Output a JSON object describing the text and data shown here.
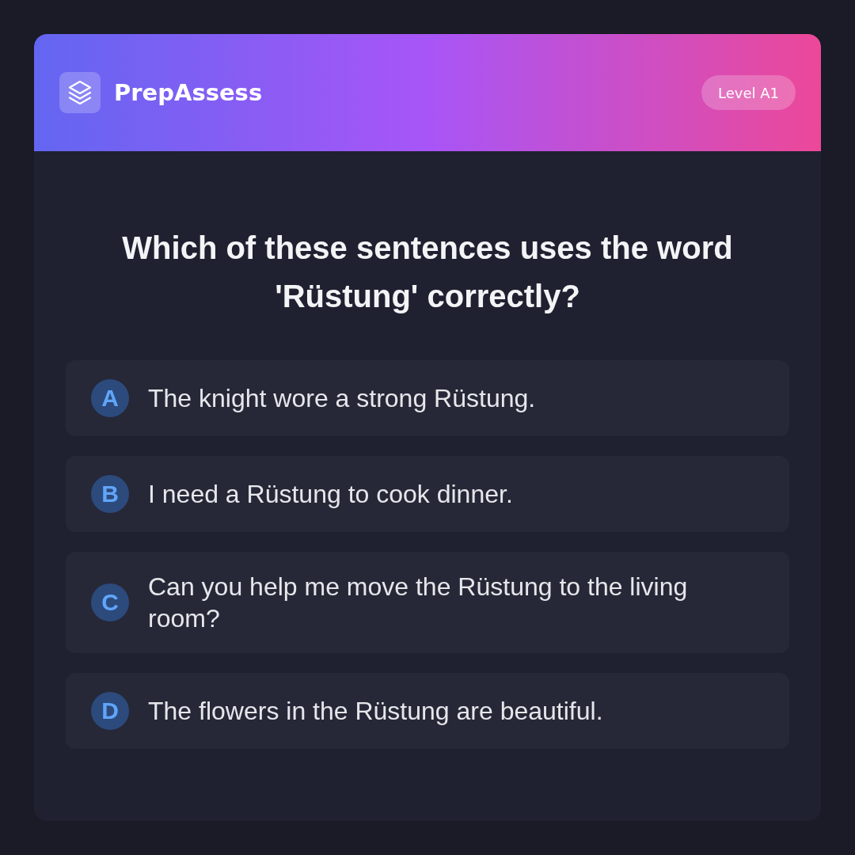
{
  "header": {
    "app_name": "PrepAssess",
    "level_badge": "Level A1"
  },
  "question": "Which of these sentences uses the word 'Rüstung' correctly?",
  "options": [
    {
      "letter": "A",
      "text": "The knight wore a strong Rüstung.",
      "selected": false
    },
    {
      "letter": "B",
      "text": "I need a Rüstung to cook dinner.",
      "selected": false
    },
    {
      "letter": "C",
      "text": "Can you help me move the Rüstung to the living room?",
      "selected": false
    },
    {
      "letter": "D",
      "text": "The flowers in the Rüstung are beautiful.",
      "selected": false
    }
  ]
}
